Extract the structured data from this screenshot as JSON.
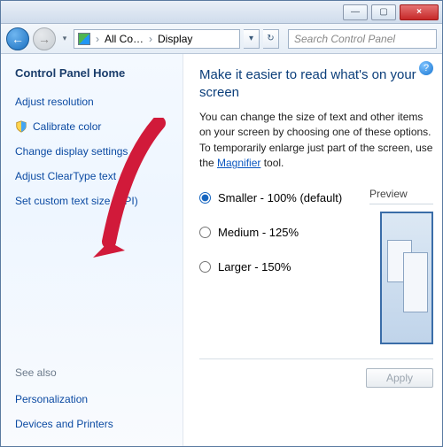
{
  "titlebar": {
    "minimize": "—",
    "maximize": "▢",
    "close": "×"
  },
  "toolbar": {
    "back_glyph": "←",
    "fwd_glyph": "→",
    "breadcrumb1": "All Co…",
    "breadcrumb2": "Display",
    "dropdown_glyph": "▾",
    "refresh_glyph": "↻",
    "search_placeholder": "Search Control Panel"
  },
  "sidebar": {
    "home": "Control Panel Home",
    "links": [
      "Adjust resolution",
      "Calibrate color",
      "Change display settings",
      "Adjust ClearType text",
      "Set custom text size (DPI)"
    ],
    "see_also_label": "See also",
    "see_also": [
      "Personalization",
      "Devices and Printers"
    ]
  },
  "main": {
    "help": "?",
    "heading": "Make it easier to read what's on your screen",
    "desc_pre": "You can change the size of text and other items on your screen by choosing one of these options. To temporarily enlarge just part of the screen, use the ",
    "magnifier_link": "Magnifier",
    "desc_post": " tool.",
    "options": [
      "Smaller - 100% (default)",
      "Medium - 125%",
      "Larger - 150%"
    ],
    "preview_label": "Preview",
    "apply_label": "Apply"
  }
}
